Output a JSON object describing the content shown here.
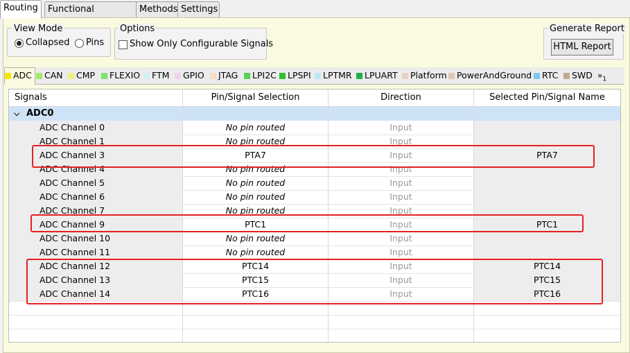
{
  "top_tabs": [
    "Routing",
    "Functional Properties",
    "Methods",
    "Settings"
  ],
  "view_mode": {
    "label": "View Mode",
    "options": [
      "Collapsed",
      "Pins"
    ],
    "selected": "Collapsed"
  },
  "options": {
    "label": "Options",
    "checkbox": "Show Only Configurable Signals",
    "checked": false
  },
  "report": {
    "label": "Generate Report",
    "button": "HTML Report"
  },
  "peripheral_tabs": [
    {
      "label": "ADC",
      "color": "#f5e600"
    },
    {
      "label": "CAN",
      "color": "#a4e86b"
    },
    {
      "label": "CMP",
      "color": "#f2ef84"
    },
    {
      "label": "FLEXIO",
      "color": "#7be36b"
    },
    {
      "label": "FTM",
      "color": "#d3f0f0"
    },
    {
      "label": "GPIO",
      "color": "#f0d2f0"
    },
    {
      "label": "JTAG",
      "color": "#f5dcc4"
    },
    {
      "label": "LPI2C",
      "color": "#5ad15a"
    },
    {
      "label": "LPSPI",
      "color": "#2fbf2f"
    },
    {
      "label": "LPTMR",
      "color": "#bfe6f5"
    },
    {
      "label": "LPUART",
      "color": "#1fb04a"
    },
    {
      "label": "Platform",
      "color": "#e6d2c4"
    },
    {
      "label": "PowerAndGround",
      "color": "#dcc8b4"
    },
    {
      "label": "RTC",
      "color": "#7ec8f0"
    },
    {
      "label": "SWD",
      "color": "#c4a890"
    }
  ],
  "more_tabs": "»",
  "more_count": "1",
  "table": {
    "headers": [
      "Signals",
      "Pin/Signal Selection",
      "Direction",
      "Selected Pin/Signal Name"
    ],
    "group": "ADC0",
    "rows": [
      {
        "signal": "ADC Channel 0",
        "pin": "No pin routed",
        "dir": "Input",
        "name": ""
      },
      {
        "signal": "ADC Channel 1",
        "pin": "No pin routed",
        "dir": "Input",
        "name": ""
      },
      {
        "signal": "ADC Channel 3",
        "pin": "PTA7",
        "dir": "Input",
        "name": "PTA7"
      },
      {
        "signal": "ADC Channel 4",
        "pin": "No pin routed",
        "dir": "Input",
        "name": ""
      },
      {
        "signal": "ADC Channel 5",
        "pin": "No pin routed",
        "dir": "Input",
        "name": ""
      },
      {
        "signal": "ADC Channel 6",
        "pin": "No pin routed",
        "dir": "Input",
        "name": ""
      },
      {
        "signal": "ADC Channel 7",
        "pin": "No pin routed",
        "dir": "Input",
        "name": ""
      },
      {
        "signal": "ADC Channel 9",
        "pin": "PTC1",
        "dir": "Input",
        "name": "PTC1"
      },
      {
        "signal": "ADC Channel 10",
        "pin": "No pin routed",
        "dir": "Input",
        "name": ""
      },
      {
        "signal": "ADC Channel 11",
        "pin": "No pin routed",
        "dir": "Input",
        "name": ""
      },
      {
        "signal": "ADC Channel 12",
        "pin": "PTC14",
        "dir": "Input",
        "name": "PTC14"
      },
      {
        "signal": "ADC Channel 13",
        "pin": "PTC15",
        "dir": "Input",
        "name": "PTC15"
      },
      {
        "signal": "ADC Channel 14",
        "pin": "PTC16",
        "dir": "Input",
        "name": "PTC16"
      }
    ]
  },
  "highlight_color": "#e52020"
}
